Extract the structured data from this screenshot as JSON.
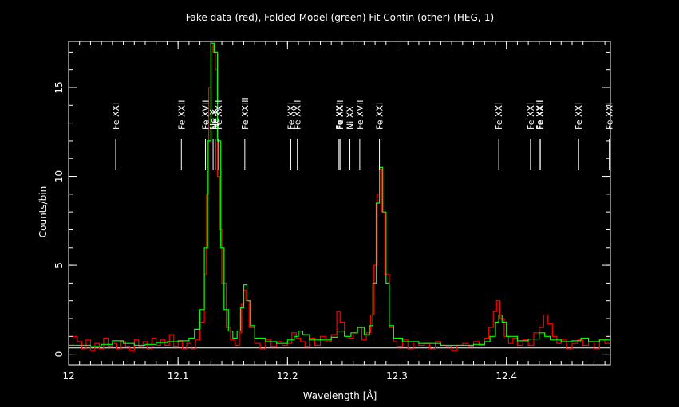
{
  "chart_data": {
    "type": "line",
    "title": "Fake data (red), Folded Model (green) Fit Contin (other) (HEG,-1)",
    "xlabel": "Wavelength [Å]",
    "ylabel": "Counts/bin",
    "xlim": [
      12.0,
      12.495
    ],
    "ylim": [
      -0.6,
      17.6
    ],
    "x_ticks": [
      {
        "value": 12.0,
        "label": "12"
      },
      {
        "value": 12.1,
        "label": "12.1"
      },
      {
        "value": 12.2,
        "label": "12.2"
      },
      {
        "value": 12.3,
        "label": "12.3"
      },
      {
        "value": 12.4,
        "label": "12.4"
      }
    ],
    "y_ticks": [
      {
        "value": 0,
        "label": "0"
      },
      {
        "value": 5,
        "label": "5"
      },
      {
        "value": 10,
        "label": "10"
      },
      {
        "value": 15,
        "label": "15"
      }
    ],
    "continuum_level": 0.35,
    "series_colors": {
      "data": "#ff0000",
      "model": "#00ff00",
      "continuum": "#ffffff"
    },
    "series": [
      {
        "values": [
          [
            12.0,
            0.5
          ],
          [
            12.004,
            1.0
          ],
          [
            12.008,
            0.7
          ],
          [
            12.012,
            0.3
          ],
          [
            12.016,
            0.8
          ],
          [
            12.02,
            0.2
          ],
          [
            12.024,
            0.6
          ],
          [
            12.028,
            0.3
          ],
          [
            12.032,
            0.9
          ],
          [
            12.036,
            0.4
          ],
          [
            12.04,
            0.6
          ],
          [
            12.044,
            0.3
          ],
          [
            12.048,
            0.7
          ],
          [
            12.052,
            0.4
          ],
          [
            12.056,
            0.2
          ],
          [
            12.06,
            0.8
          ],
          [
            12.064,
            0.4
          ],
          [
            12.068,
            0.7
          ],
          [
            12.072,
            0.3
          ],
          [
            12.076,
            0.9
          ],
          [
            12.08,
            0.5
          ],
          [
            12.084,
            0.8
          ],
          [
            12.088,
            0.5
          ],
          [
            12.092,
            1.1
          ],
          [
            12.096,
            0.4
          ],
          [
            12.1,
            0.7
          ],
          [
            12.104,
            0.3
          ],
          [
            12.108,
            0.6
          ],
          [
            12.112,
            0.3
          ],
          [
            12.116,
            0.8
          ],
          [
            12.12,
            1.8
          ],
          [
            12.124,
            4.5
          ],
          [
            12.126,
            9.0
          ],
          [
            12.128,
            15.0
          ],
          [
            12.13,
            17.5
          ],
          [
            12.132,
            17.0
          ],
          [
            12.134,
            16.0
          ],
          [
            12.136,
            10.0
          ],
          [
            12.138,
            7.0
          ],
          [
            12.14,
            4.0
          ],
          [
            12.144,
            1.5
          ],
          [
            12.148,
            0.8
          ],
          [
            12.152,
            0.5
          ],
          [
            12.156,
            1.2
          ],
          [
            12.158,
            2.8
          ],
          [
            12.16,
            3.6
          ],
          [
            12.162,
            3.0
          ],
          [
            12.165,
            1.5
          ],
          [
            12.17,
            0.6
          ],
          [
            12.175,
            0.3
          ],
          [
            12.18,
            0.8
          ],
          [
            12.185,
            0.4
          ],
          [
            12.19,
            0.7
          ],
          [
            12.195,
            0.5
          ],
          [
            12.2,
            0.6
          ],
          [
            12.204,
            1.2
          ],
          [
            12.208,
            0.9
          ],
          [
            12.212,
            0.7
          ],
          [
            12.216,
            0.4
          ],
          [
            12.22,
            0.9
          ],
          [
            12.225,
            0.5
          ],
          [
            12.23,
            1.0
          ],
          [
            12.235,
            0.7
          ],
          [
            12.24,
            1.1
          ],
          [
            12.245,
            2.4
          ],
          [
            12.248,
            1.8
          ],
          [
            12.252,
            1.0
          ],
          [
            12.256,
            0.9
          ],
          [
            12.26,
            1.2
          ],
          [
            12.264,
            1.5
          ],
          [
            12.268,
            0.8
          ],
          [
            12.272,
            1.2
          ],
          [
            12.276,
            2.2
          ],
          [
            12.279,
            5.0
          ],
          [
            12.282,
            9.0
          ],
          [
            12.284,
            10.4
          ],
          [
            12.286,
            8.0
          ],
          [
            12.289,
            4.5
          ],
          [
            12.293,
            1.5
          ],
          [
            12.297,
            0.7
          ],
          [
            12.3,
            0.4
          ],
          [
            12.305,
            0.8
          ],
          [
            12.31,
            0.3
          ],
          [
            12.315,
            0.7
          ],
          [
            12.32,
            0.5
          ],
          [
            12.325,
            0.6
          ],
          [
            12.33,
            0.3
          ],
          [
            12.335,
            0.7
          ],
          [
            12.34,
            0.5
          ],
          [
            12.345,
            0.4
          ],
          [
            12.35,
            0.2
          ],
          [
            12.355,
            0.5
          ],
          [
            12.36,
            0.6
          ],
          [
            12.365,
            0.4
          ],
          [
            12.37,
            0.7
          ],
          [
            12.375,
            0.5
          ],
          [
            12.38,
            0.9
          ],
          [
            12.384,
            1.5
          ],
          [
            12.388,
            2.4
          ],
          [
            12.391,
            3.0
          ],
          [
            12.394,
            2.0
          ],
          [
            12.398,
            1.0
          ],
          [
            12.402,
            0.6
          ],
          [
            12.406,
            0.9
          ],
          [
            12.41,
            0.5
          ],
          [
            12.415,
            0.8
          ],
          [
            12.42,
            0.5
          ],
          [
            12.425,
            1.2
          ],
          [
            12.43,
            1.5
          ],
          [
            12.434,
            2.2
          ],
          [
            12.438,
            1.7
          ],
          [
            12.442,
            1.0
          ],
          [
            12.446,
            0.6
          ],
          [
            12.45,
            0.8
          ],
          [
            12.455,
            0.3
          ],
          [
            12.46,
            0.6
          ],
          [
            12.465,
            0.8
          ],
          [
            12.47,
            0.5
          ],
          [
            12.475,
            0.7
          ],
          [
            12.48,
            0.3
          ],
          [
            12.485,
            0.8
          ],
          [
            12.49,
            0.6
          ],
          [
            12.495,
            0.5
          ]
        ]
      },
      {
        "values": [
          [
            12.0,
            0.5
          ],
          [
            12.02,
            0.45
          ],
          [
            12.03,
            0.55
          ],
          [
            12.04,
            0.75
          ],
          [
            12.05,
            0.6
          ],
          [
            12.06,
            0.5
          ],
          [
            12.07,
            0.55
          ],
          [
            12.08,
            0.65
          ],
          [
            12.09,
            0.7
          ],
          [
            12.1,
            0.75
          ],
          [
            12.11,
            0.9
          ],
          [
            12.115,
            1.4
          ],
          [
            12.12,
            2.5
          ],
          [
            12.124,
            6.0
          ],
          [
            12.127,
            12.0
          ],
          [
            12.13,
            17.5
          ],
          [
            12.133,
            17.0
          ],
          [
            12.136,
            12.0
          ],
          [
            12.139,
            6.0
          ],
          [
            12.142,
            2.5
          ],
          [
            12.146,
            1.3
          ],
          [
            12.15,
            0.9
          ],
          [
            12.154,
            1.3
          ],
          [
            12.157,
            2.6
          ],
          [
            12.16,
            3.9
          ],
          [
            12.163,
            3.0
          ],
          [
            12.166,
            1.6
          ],
          [
            12.17,
            0.9
          ],
          [
            12.18,
            0.7
          ],
          [
            12.19,
            0.6
          ],
          [
            12.2,
            0.8
          ],
          [
            12.206,
            1.0
          ],
          [
            12.21,
            1.3
          ],
          [
            12.214,
            1.1
          ],
          [
            12.22,
            0.8
          ],
          [
            12.23,
            0.8
          ],
          [
            12.24,
            0.95
          ],
          [
            12.246,
            1.3
          ],
          [
            12.252,
            1.0
          ],
          [
            12.258,
            1.2
          ],
          [
            12.264,
            1.5
          ],
          [
            12.27,
            1.1
          ],
          [
            12.275,
            1.6
          ],
          [
            12.278,
            4.0
          ],
          [
            12.281,
            8.5
          ],
          [
            12.284,
            10.5
          ],
          [
            12.287,
            8.0
          ],
          [
            12.29,
            4.0
          ],
          [
            12.293,
            1.6
          ],
          [
            12.297,
            0.9
          ],
          [
            12.305,
            0.7
          ],
          [
            12.32,
            0.6
          ],
          [
            12.34,
            0.5
          ],
          [
            12.36,
            0.5
          ],
          [
            12.37,
            0.55
          ],
          [
            12.38,
            0.7
          ],
          [
            12.385,
            1.0
          ],
          [
            12.39,
            1.8
          ],
          [
            12.393,
            2.2
          ],
          [
            12.396,
            1.8
          ],
          [
            12.4,
            1.0
          ],
          [
            12.41,
            0.75
          ],
          [
            12.42,
            0.85
          ],
          [
            12.43,
            1.2
          ],
          [
            12.435,
            1.0
          ],
          [
            12.44,
            0.8
          ],
          [
            12.45,
            0.7
          ],
          [
            12.46,
            0.75
          ],
          [
            12.468,
            0.9
          ],
          [
            12.475,
            0.7
          ],
          [
            12.485,
            0.8
          ],
          [
            12.495,
            1.0
          ]
        ]
      }
    ],
    "line_ids": [
      {
        "x": 12.043,
        "label": "Fe XXI"
      },
      {
        "x": 12.103,
        "label": "Fe XXII"
      },
      {
        "x": 12.125,
        "label": "Fe XVII"
      },
      {
        "x": 12.132,
        "label": "Ne X"
      },
      {
        "x": 12.134,
        "label": "Ne X"
      },
      {
        "x": 12.137,
        "label": "Fe XXII"
      },
      {
        "x": 12.161,
        "label": "Fe XXIII"
      },
      {
        "x": 12.203,
        "label": "Fe XXI"
      },
      {
        "x": 12.209,
        "label": "Fe XXII"
      },
      {
        "x": 12.247,
        "label": "Fe XXI"
      },
      {
        "x": 12.248,
        "label": "Fe XXII"
      },
      {
        "x": 12.257,
        "label": "Ni XX"
      },
      {
        "x": 12.266,
        "label": "Fe XVII"
      },
      {
        "x": 12.284,
        "label": "Fe XXI"
      },
      {
        "x": 12.393,
        "label": "Fe XXI"
      },
      {
        "x": 12.422,
        "label": "Fe XXI"
      },
      {
        "x": 12.43,
        "label": "Fe XXII"
      },
      {
        "x": 12.431,
        "label": "Fe XXII"
      },
      {
        "x": 12.466,
        "label": "Fe XXI"
      },
      {
        "x": 12.494,
        "label": "Fe XXI"
      }
    ]
  }
}
